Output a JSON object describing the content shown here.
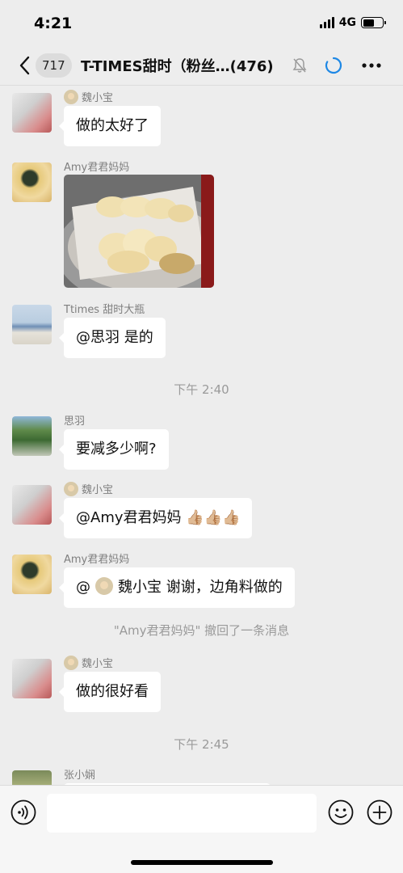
{
  "status": {
    "time": "4:21",
    "network": "4G"
  },
  "nav": {
    "unread_count": "717",
    "title": "T-TIMES甜时（粉丝…(476)"
  },
  "messages": [
    {
      "sender": "魏小宝",
      "text": "做的太好了"
    },
    {
      "sender": "Amy君君妈妈",
      "image": "bread-photo"
    },
    {
      "sender": "Ttimes 甜时大瓶",
      "text": "@思羽 是的"
    },
    {
      "sender": "思羽",
      "text": "要减多少啊?"
    },
    {
      "sender": "魏小宝",
      "text": "@Amy君君妈妈 👍🏼👍🏼👍🏼"
    },
    {
      "sender": "Amy君君妈妈",
      "text_prefix": "@",
      "text_suffix": "魏小宝 谢谢，边角料做的"
    },
    {
      "sender": "魏小宝",
      "text": "做的很好看"
    },
    {
      "sender": "张小娴"
    }
  ],
  "timestamps": [
    "下午 2:40",
    "下午 2:45"
  ],
  "recall_notice": "\"Amy君君妈妈\" 撤回了一条消息",
  "input": {
    "value": "",
    "placeholder": ""
  },
  "colors": {
    "background": "#ededed",
    "bubble": "#ffffff",
    "system_text": "#9a9a9a",
    "accent_blue": "#1e88e5"
  },
  "icons": [
    "back-icon",
    "mute-bell-icon",
    "loading-icon",
    "more-icon",
    "voice-icon",
    "emoji-icon",
    "plus-icon"
  ]
}
